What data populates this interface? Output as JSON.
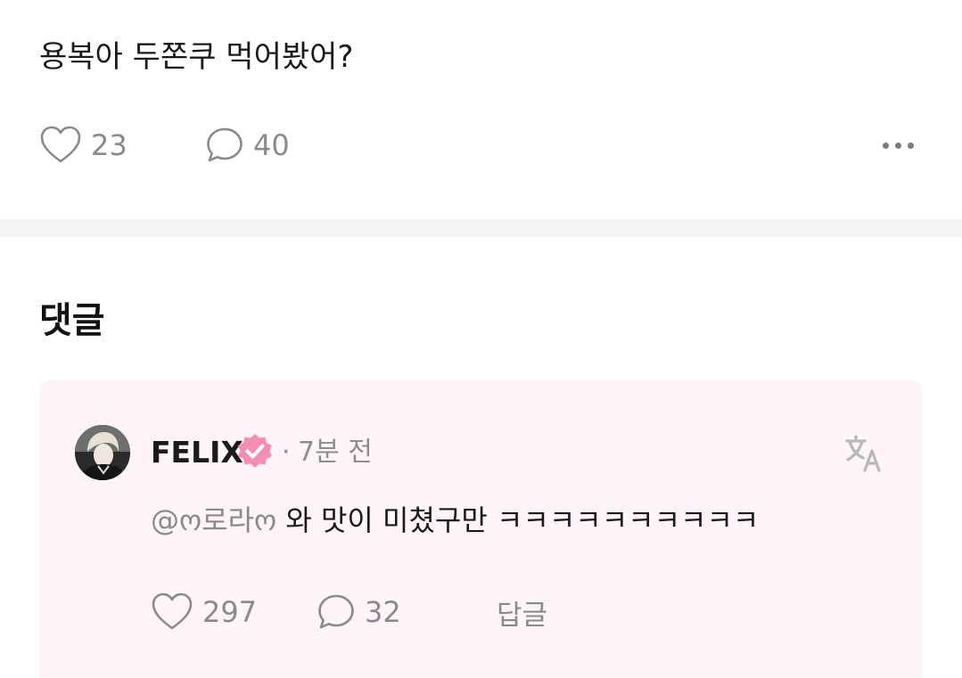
{
  "post": {
    "text": "용복아 두쫀쿠 먹어봤어?",
    "like_count": "23",
    "comment_count": "40"
  },
  "comments_section": {
    "title": "댓글"
  },
  "comment": {
    "author": "FELIX",
    "separator": "·",
    "time": "7분 전",
    "mention": "@ო로라ო",
    "text": " 와 맛이 미쳤구만 ㅋㅋㅋㅋㅋㅋㅋㅋㅋㅋ",
    "like_count": "297",
    "comment_count": "32",
    "reply_label": "답글",
    "verified_color": "#f58fb2",
    "card_background": "#fff5f8"
  },
  "icons": {
    "like": "heart-icon",
    "comment": "speech-bubble-icon",
    "more": "more-horizontal-icon",
    "translate": "translate-icon",
    "verified": "verified-badge-icon"
  }
}
